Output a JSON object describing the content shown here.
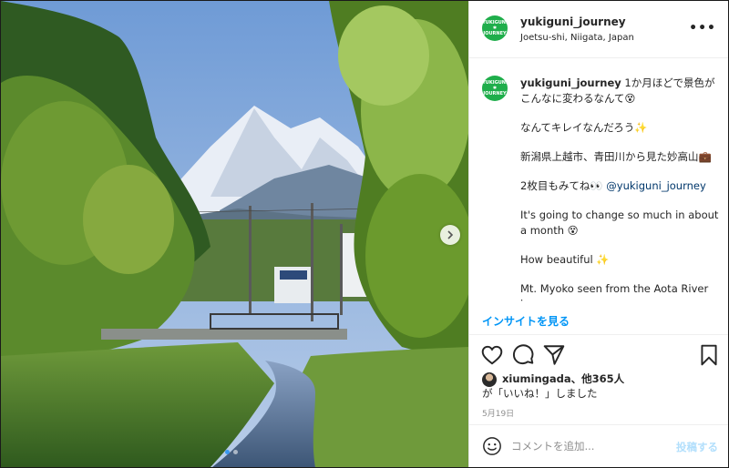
{
  "post": {
    "username": "yukiguni_journey",
    "location": "Joetsu-shi, Niigata, Japan",
    "avatar_text": [
      "YUKIGUNI",
      "✱",
      "JOURNEY"
    ],
    "more_icon": "ellipsis-icon"
  },
  "caption": {
    "username": "yukiguni_journey",
    "line1": "1か月ほどで景色がこんなに変わるなんて😵",
    "line2": "なんてキレイなんだろう✨",
    "line3": "新潟県上越市、青田川から見た妙高山💼",
    "line4_text": "2枚目もみてね👀",
    "line4_mention": "@yukiguni_journey",
    "line5": "It's going to change so much in about a month 😵",
    "line6": "How beautiful ✨",
    "line7": "Mt. Myoko seen from the Aota River in"
  },
  "insights_label": "インサイトを見る",
  "likes": {
    "bold_text": "xiumingada、他365人",
    "suffix_text": "が「いいね！」しました"
  },
  "date": "5月19日",
  "comment": {
    "placeholder": "コメントを追加...",
    "post_label": "投稿する"
  },
  "carousel": {
    "current_index": 1,
    "total": 2
  },
  "colors": {
    "accent": "#0095f6",
    "avatar_green": "#1fae4b",
    "post_button_disabled": "#b2dffc"
  }
}
